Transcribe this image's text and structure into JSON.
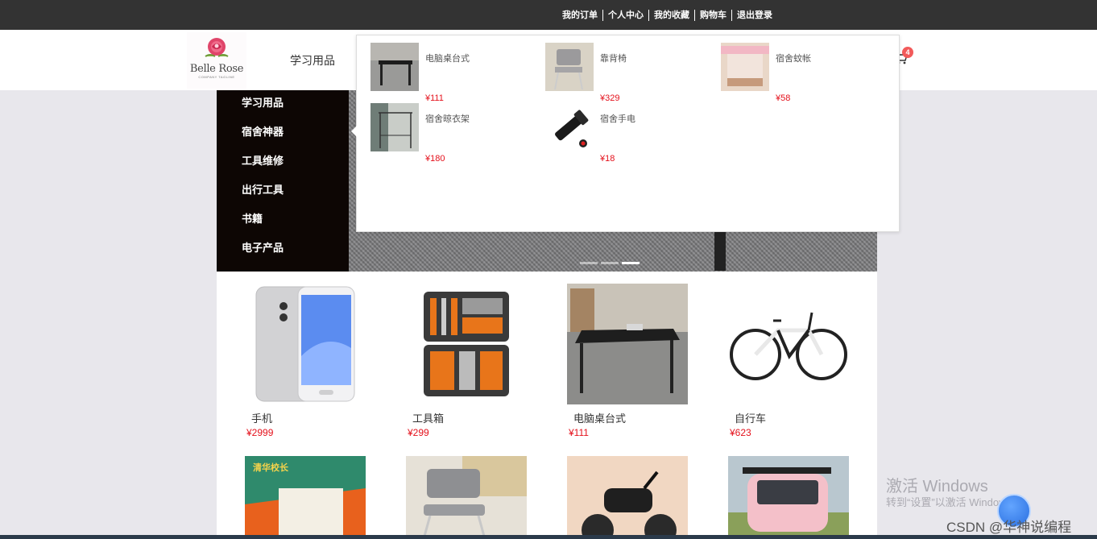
{
  "topbar": {
    "links": [
      "我的订单",
      "个人中心",
      "我的收藏",
      "购物车",
      "退出登录"
    ]
  },
  "header": {
    "logo_brand": "Belle Rose",
    "logo_tagline": "COMPANY TAGLINE",
    "nav_first": "学习用品",
    "cart_count": "4"
  },
  "sidebar": {
    "items": [
      "学习用品",
      "宿舍神器",
      "工具维修",
      "出行工具",
      "书籍",
      "电子产品"
    ]
  },
  "dropdown": {
    "items": [
      {
        "name": "电脑桌台式",
        "price": "¥111"
      },
      {
        "name": "靠背椅",
        "price": "¥329"
      },
      {
        "name": "宿舍蚊帐",
        "price": "¥58"
      },
      {
        "name": "宿舍晾衣架",
        "price": "¥180"
      },
      {
        "name": "宿舍手电",
        "price": "¥18"
      }
    ]
  },
  "products": [
    {
      "name": "手机",
      "price": "¥2999"
    },
    {
      "name": "工具箱",
      "price": "¥299"
    },
    {
      "name": "电脑桌台式",
      "price": "¥111"
    },
    {
      "name": "自行车",
      "price": "¥623"
    }
  ],
  "row2": {
    "book_title": "清华校长"
  },
  "watermark": {
    "windows_title": "激活 Windows",
    "windows_sub": "转到“设置”以激活 Windows。",
    "csdn": "CSDN @华神说编程"
  },
  "colors": {
    "topbar": "#333333",
    "sidebar": "#0d0604",
    "price": "#e4101b",
    "badge": "#f25a5a"
  }
}
